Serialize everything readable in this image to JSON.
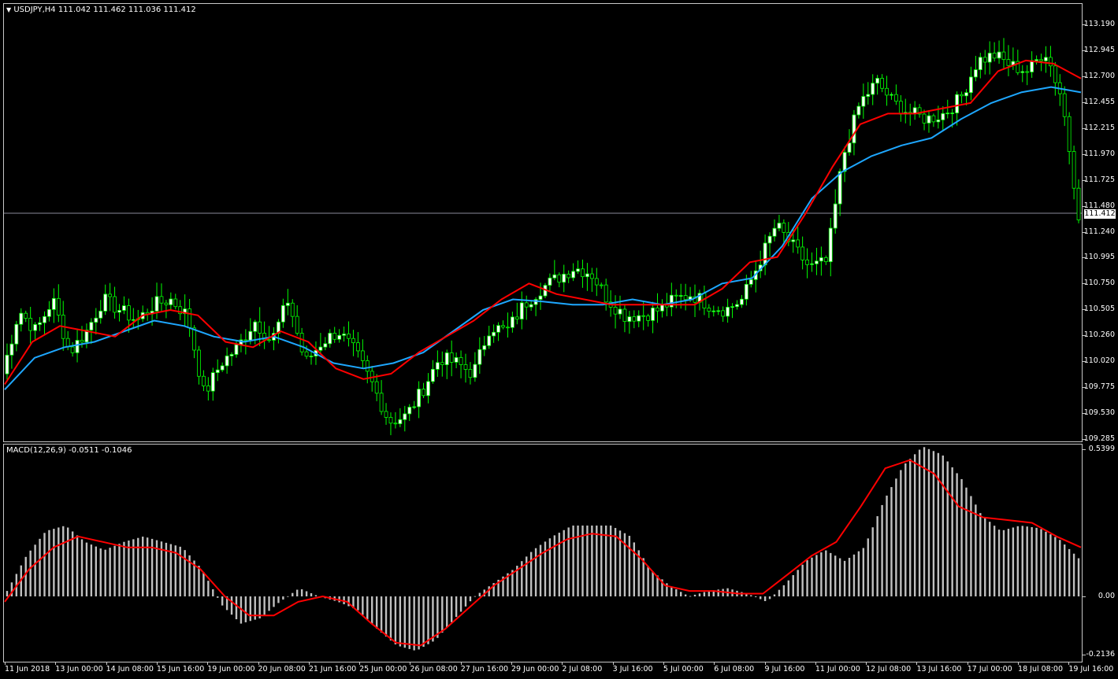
{
  "main_header": {
    "arrow": "▼",
    "text": "USDJPY,H4  111.042 111.462 111.036 111.412"
  },
  "macd_header": {
    "text": "MACD(12,26,9) -0.0511 -0.1046"
  },
  "current_price": "111.412",
  "price_axis": [
    "113.190",
    "112.945",
    "112.700",
    "112.455",
    "112.215",
    "111.970",
    "111.725",
    "111.480",
    "111.240",
    "110.995",
    "110.750",
    "110.505",
    "110.260",
    "110.020",
    "109.775",
    "109.530",
    "109.285"
  ],
  "macd_axis": [
    "0.5399",
    "0.00",
    "-0.2136"
  ],
  "time_axis": [
    "11 Jun 2018",
    "13 Jun 00:00",
    "14 Jun 08:00",
    "15 Jun 16:00",
    "19 Jun 00:00",
    "20 Jun 08:00",
    "21 Jun 16:00",
    "25 Jun 00:00",
    "26 Jun 08:00",
    "27 Jun 16:00",
    "29 Jun 00:00",
    "2 Jul 08:00",
    "3 Jul 16:00",
    "5 Jul 00:00",
    "6 Jul 08:00",
    "9 Jul 16:00",
    "11 Jul 00:00",
    "12 Jul 08:00",
    "13 Jul 16:00",
    "17 Jul 00:00",
    "18 Jul 08:00",
    "19 Jul 16:00"
  ],
  "colors": {
    "background": "#000000",
    "bull_candle": "#ffffff",
    "bear_candle": "#000000",
    "wick": "#00ff00",
    "fast_ma": "#ff0000",
    "slow_ma": "#1ea7ff",
    "macd_hist": "#c0c0c0",
    "macd_signal": "#ff0000",
    "grid": "#c8c8c8"
  },
  "chart_data": [
    {
      "type": "candlestick",
      "symbol": "USDJPY",
      "timeframe": "H4",
      "ylim": [
        109.285,
        113.19
      ],
      "close_anchors": [
        109.9,
        110.5,
        110.3,
        110.6,
        110.1,
        110.3,
        110.6,
        110.5,
        110.4,
        110.55,
        110.6,
        110.45,
        109.7,
        110.0,
        110.15,
        110.4,
        110.2,
        110.6,
        110.0,
        110.2,
        110.3,
        110.1,
        109.8,
        109.45,
        109.5,
        109.75,
        110.05,
        110.0,
        109.9,
        110.35,
        110.3,
        110.55,
        110.7,
        110.8,
        110.9,
        110.85,
        110.6,
        110.45,
        110.45,
        110.5,
        110.6,
        110.65,
        110.55,
        110.5,
        110.6,
        110.95,
        111.3,
        111.1,
        110.9,
        110.95,
        111.95,
        112.45,
        112.65,
        112.45,
        112.35,
        112.3,
        112.35,
        112.5,
        112.85,
        112.9,
        112.8,
        112.75,
        112.95,
        112.5,
        111.41
      ],
      "series": [
        {
          "name": "fast MA",
          "values": [
            109.8,
            110.2,
            110.35,
            110.3,
            110.25,
            110.45,
            110.5,
            110.45,
            110.2,
            110.15,
            110.3,
            110.2,
            109.95,
            109.85,
            109.9,
            110.1,
            110.25,
            110.4,
            110.6,
            110.75,
            110.65,
            110.6,
            110.55,
            110.55,
            110.55,
            110.55,
            110.7,
            110.95,
            111.0,
            111.4,
            111.85,
            112.25,
            112.35,
            112.35,
            112.4,
            112.45,
            112.75,
            112.85,
            112.82,
            112.68
          ]
        },
        {
          "name": "slow MA",
          "values": [
            109.75,
            110.05,
            110.15,
            110.2,
            110.3,
            110.4,
            110.35,
            110.25,
            110.2,
            110.25,
            110.15,
            110.0,
            109.95,
            110.0,
            110.1,
            110.3,
            110.5,
            110.6,
            110.58,
            110.55,
            110.55,
            110.6,
            110.55,
            110.6,
            110.75,
            110.8,
            111.1,
            111.55,
            111.8,
            111.95,
            112.05,
            112.12,
            112.3,
            112.45,
            112.55,
            112.6,
            112.55
          ]
        }
      ]
    },
    {
      "type": "bar",
      "name": "MACD(12,26,9)",
      "ylim": [
        -0.2136,
        0.5399
      ],
      "values": [
        0.02,
        0.15,
        0.24,
        0.26,
        0.2,
        0.17,
        0.2,
        0.22,
        0.2,
        0.18,
        0.1,
        -0.03,
        -0.1,
        -0.08,
        -0.02,
        0.03,
        0.0,
        -0.02,
        -0.05,
        -0.12,
        -0.18,
        -0.2,
        -0.16,
        -0.08,
        0.0,
        0.05,
        0.1,
        0.17,
        0.22,
        0.26,
        0.26,
        0.26,
        0.22,
        0.1,
        0.04,
        0.0,
        0.02,
        0.03,
        0.01,
        -0.02,
        0.05,
        0.13,
        0.17,
        0.13,
        0.18,
        0.35,
        0.48,
        0.55,
        0.52,
        0.43,
        0.3,
        0.24,
        0.26,
        0.25,
        0.21,
        0.14
      ],
      "series": [
        {
          "name": "signal",
          "values": [
            -0.02,
            0.1,
            0.18,
            0.22,
            0.2,
            0.18,
            0.18,
            0.16,
            0.1,
            0.0,
            -0.07,
            -0.07,
            -0.02,
            0.0,
            -0.02,
            -0.1,
            -0.17,
            -0.18,
            -0.12,
            -0.04,
            0.04,
            0.1,
            0.16,
            0.21,
            0.23,
            0.22,
            0.14,
            0.04,
            0.02,
            0.02,
            0.01,
            0.01,
            0.08,
            0.15,
            0.2,
            0.33,
            0.47,
            0.5,
            0.45,
            0.33,
            0.29,
            0.28,
            0.27,
            0.22,
            0.18
          ]
        }
      ]
    }
  ]
}
